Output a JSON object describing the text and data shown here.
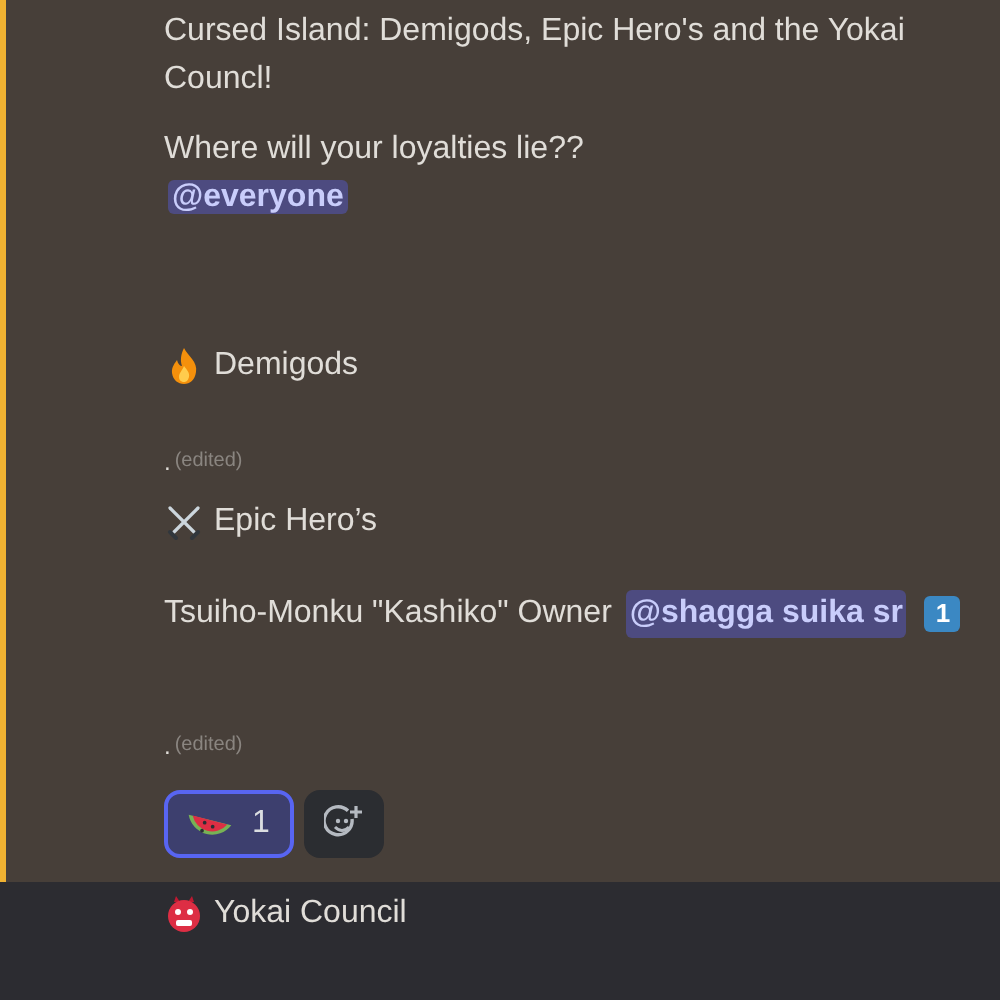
{
  "message": {
    "blocks": [
      {
        "kind": "text",
        "text": "Cursed Island: Demigods, Epic Hero's and the Yokai Councl!"
      },
      {
        "kind": "text",
        "text": "Where will your loyalties lie??"
      },
      {
        "kind": "mention",
        "text": "@everyone"
      },
      {
        "kind": "heading",
        "text": "Demigods"
      },
      {
        "kind": "edited",
        "text": ".",
        "tag": "(edited)"
      },
      {
        "kind": "heading",
        "text": "Epic Hero’s"
      },
      {
        "kind": "owner",
        "text": "Tsuiho-Monku \"Kashiko\" Owner",
        "mention": "@shagga suika sr",
        "keycap": "1"
      },
      {
        "kind": "edited",
        "text": ".",
        "tag": "(edited)"
      }
    ],
    "reactions": [
      {
        "count": "1",
        "selected": true
      }
    ]
  },
  "next_message": {
    "text": "Yokai Council"
  }
}
